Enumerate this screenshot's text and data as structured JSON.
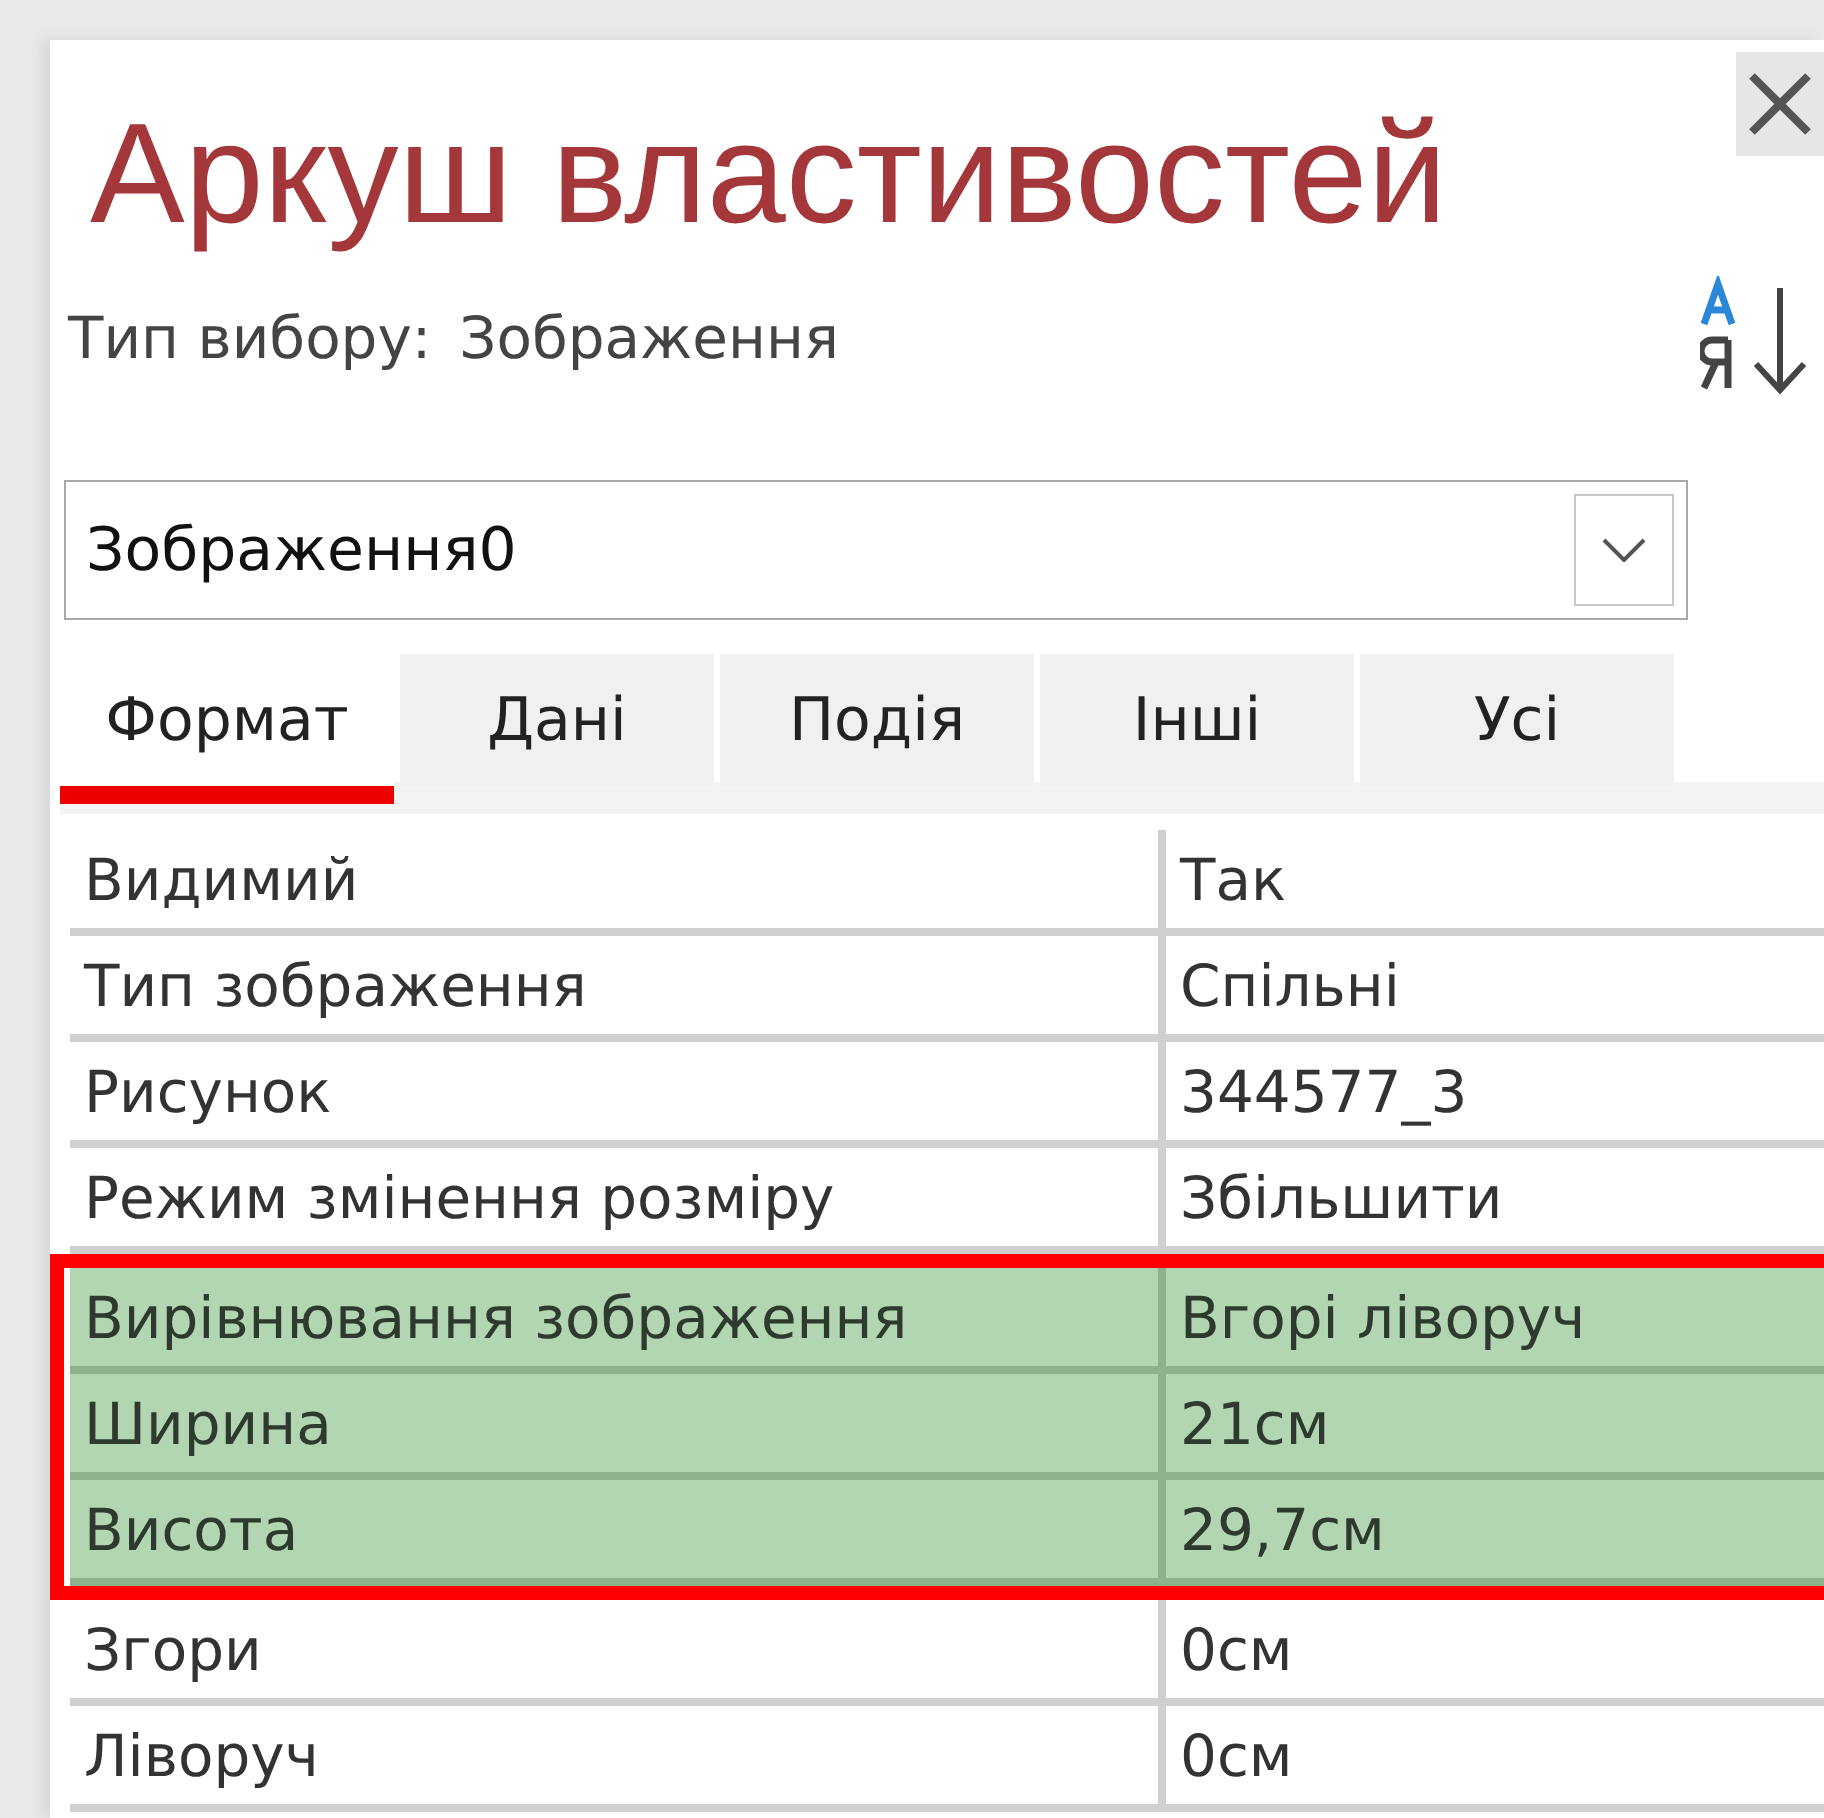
{
  "window": {
    "title": "Аркуш властивостей"
  },
  "selection_type": {
    "label": "Тип вибору:",
    "value": "Зображення"
  },
  "object_selector": {
    "value": "Зображення0"
  },
  "tabs": [
    {
      "label": "Формат",
      "selected": true
    },
    {
      "label": "Дані",
      "selected": false
    },
    {
      "label": "Подія",
      "selected": false
    },
    {
      "label": "Інші",
      "selected": false
    },
    {
      "label": "Усі",
      "selected": false
    }
  ],
  "properties": [
    {
      "name": "Видимий",
      "value": "Так",
      "highlighted": false
    },
    {
      "name": "Тип зображення",
      "value": "Спільні",
      "highlighted": false
    },
    {
      "name": "Рисунок",
      "value": "344577_3",
      "highlighted": false
    },
    {
      "name": "Режим змінення розміру",
      "value": "Збільшити",
      "highlighted": false
    },
    {
      "name": "Вирівнювання зображення",
      "value": "Вгорі ліворуч",
      "highlighted": true
    },
    {
      "name": "Ширина",
      "value": "21см",
      "highlighted": true
    },
    {
      "name": "Висота",
      "value": "29,7см",
      "highlighted": true
    },
    {
      "name": "Згори",
      "value": "0см",
      "highlighted": false
    },
    {
      "name": "Ліворуч",
      "value": "0см",
      "highlighted": false
    }
  ]
}
